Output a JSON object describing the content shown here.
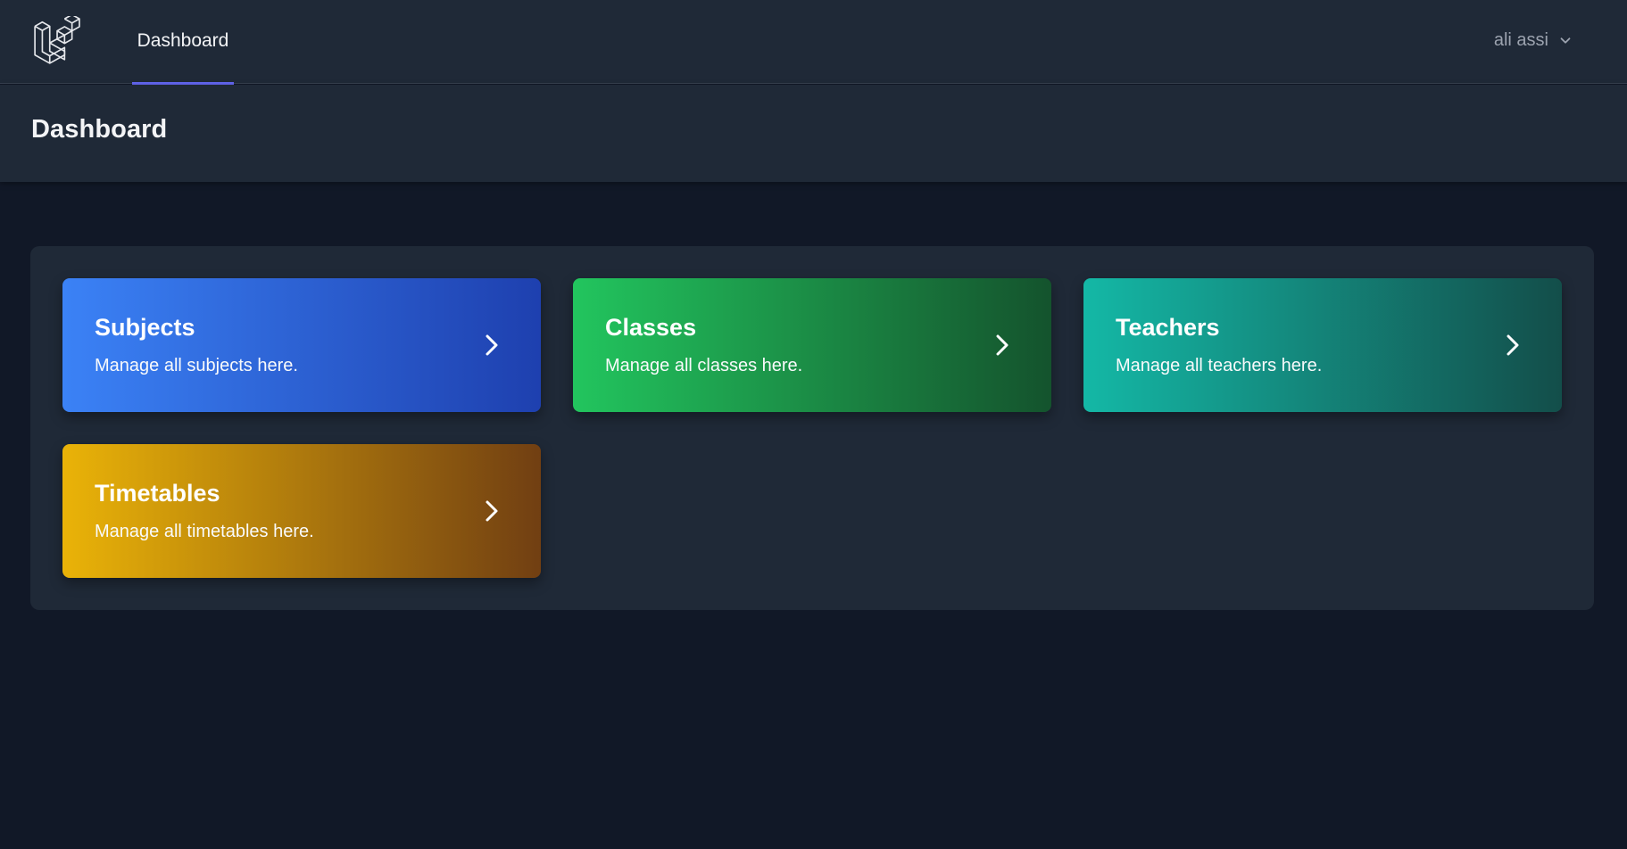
{
  "nav": {
    "logo_icon": "laravel-logo-icon",
    "links": [
      {
        "label": "Dashboard",
        "active": true
      }
    ],
    "accent_color": "#6366f1"
  },
  "user_menu": {
    "name": "ali assi",
    "icon": "chevron-down-icon"
  },
  "header": {
    "title": "Dashboard"
  },
  "cards": [
    {
      "title": "Subjects",
      "description": "Manage all subjects here.",
      "gradient_from": "#3b82f6",
      "gradient_to": "#1e40af",
      "icon": "chevron-right-icon"
    },
    {
      "title": "Classes",
      "description": "Manage all classes here.",
      "gradient_from": "#22c55e",
      "gradient_to": "#14532d",
      "icon": "chevron-right-icon"
    },
    {
      "title": "Teachers",
      "description": "Manage all teachers here.",
      "gradient_from": "#14b8a6",
      "gradient_to": "#134e4a",
      "icon": "chevron-right-icon"
    },
    {
      "title": "Timetables",
      "description": "Manage all timetables here.",
      "gradient_from": "#eab308",
      "gradient_to": "#713f12",
      "icon": "chevron-right-icon"
    }
  ]
}
